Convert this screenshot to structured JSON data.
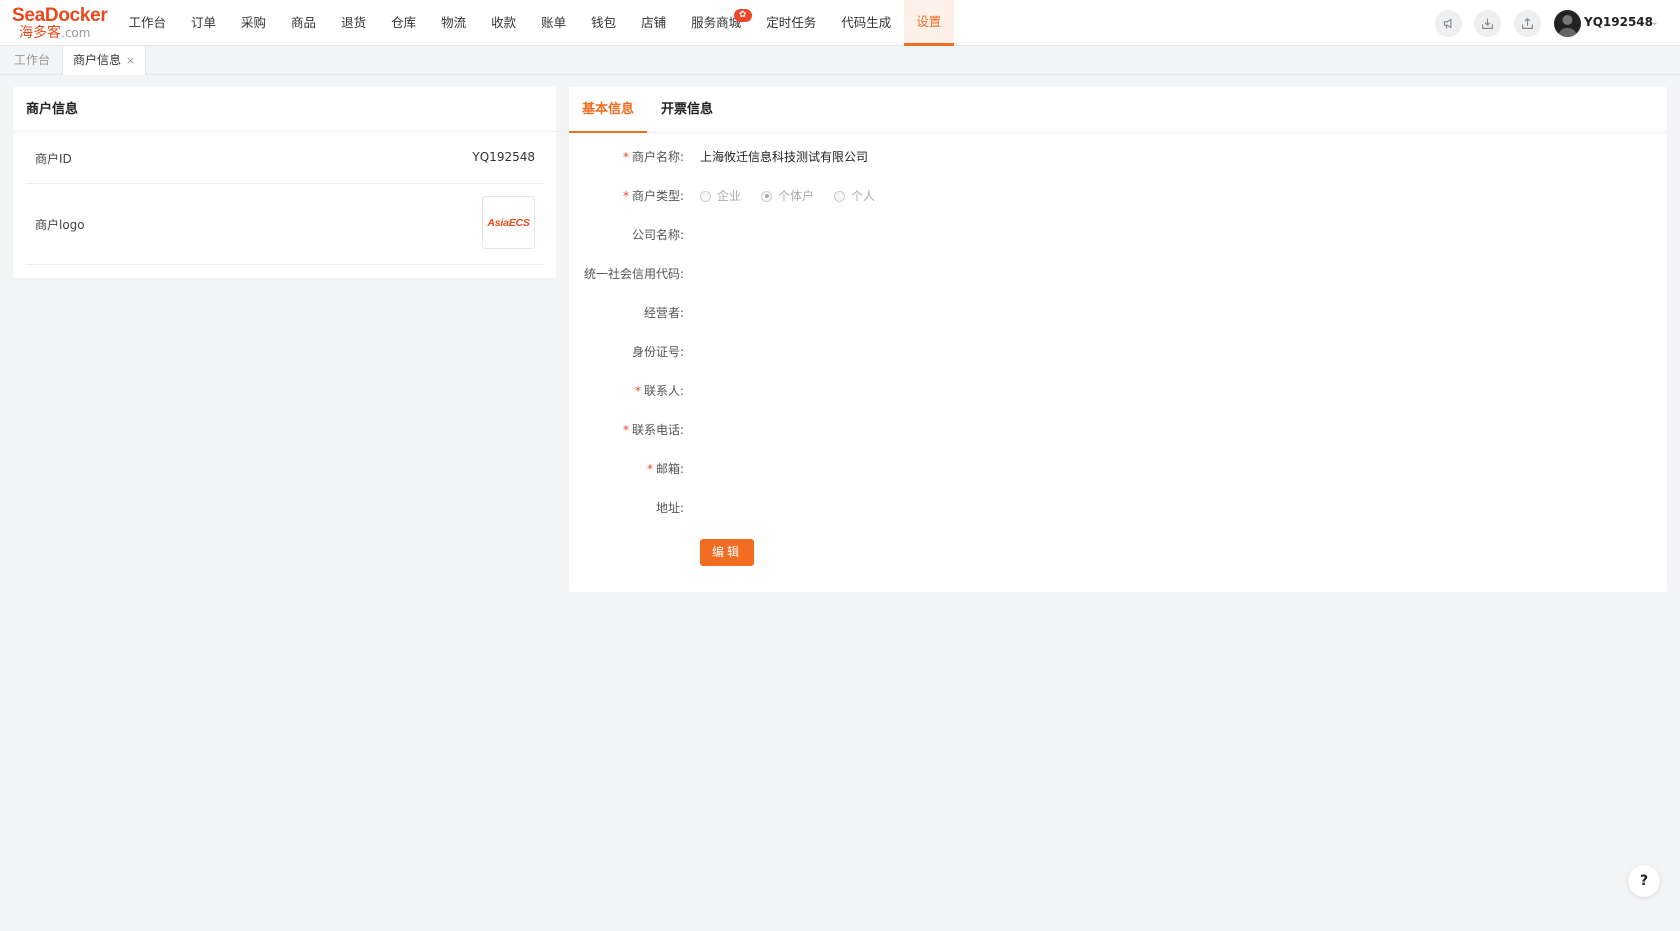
{
  "brand": {
    "name_top": "SeaDocker",
    "name_bottom": "海多客",
    "domain_suffix": ".com",
    "accent_color": "#f26c22"
  },
  "nav": {
    "items": [
      {
        "label": "工作台"
      },
      {
        "label": "订单"
      },
      {
        "label": "采购"
      },
      {
        "label": "商品"
      },
      {
        "label": "退货"
      },
      {
        "label": "仓库"
      },
      {
        "label": "物流"
      },
      {
        "label": "收款"
      },
      {
        "label": "账单"
      },
      {
        "label": "钱包"
      },
      {
        "label": "店铺"
      },
      {
        "label": "服务商城",
        "badge": "✿"
      },
      {
        "label": "定时任务"
      },
      {
        "label": "代码生成"
      },
      {
        "label": "设置",
        "active": true
      }
    ]
  },
  "header_icons": [
    "announcement-icon",
    "download-icon",
    "upload-icon"
  ],
  "user": {
    "name": "YQ192548"
  },
  "tabs": [
    {
      "label": "工作台"
    },
    {
      "label": "商户信息",
      "close": "×"
    }
  ],
  "merchant_card": {
    "title": "商户信息",
    "id_label": "商户ID",
    "id_value": "YQ192548",
    "logo_label": "商户logo",
    "logo_text": "AsiaECS"
  },
  "detail": {
    "tabs": [
      "基本信息",
      "开票信息"
    ],
    "fields": {
      "merchant_name": {
        "label": "商户名称:",
        "required": "*",
        "value": "上海攸迁信息科技测试有限公司"
      },
      "merchant_type": {
        "label": "商户类型:",
        "required": "*",
        "options": [
          "企业",
          "个体户",
          "个人"
        ],
        "selected": "个体户"
      },
      "company_name": {
        "label": "公司名称:",
        "value": ""
      },
      "credit_code": {
        "label": "统一社会信用代码:",
        "value": ""
      },
      "operator": {
        "label": "经营者:",
        "value": ""
      },
      "id_number": {
        "label": "身份证号:",
        "value": ""
      },
      "contact": {
        "label": "联系人:",
        "required": "*",
        "value": ""
      },
      "phone": {
        "label": "联系电话:",
        "required": "*",
        "value": ""
      },
      "email": {
        "label": "邮箱:",
        "required": "*",
        "value": ""
      },
      "address": {
        "label": "地址:",
        "value": ""
      }
    },
    "edit_button": "编辑"
  },
  "help": {
    "label": "?"
  }
}
